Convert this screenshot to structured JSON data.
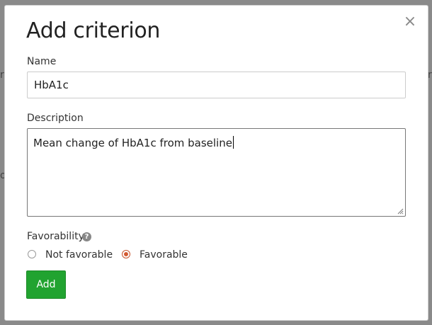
{
  "backdrop": {
    "left_fragment": "r",
    "right_fragment": "r",
    "left_fragment2": "o"
  },
  "dialog": {
    "title": "Add criterion",
    "close_symbol": "×",
    "name": {
      "label": "Name",
      "value": "HbA1c"
    },
    "description": {
      "label": "Description",
      "value": "Mean change of HbA1c from baseline"
    },
    "favorability": {
      "label": "Favorability",
      "help_symbol": "?",
      "options": [
        {
          "label": "Not favorable",
          "checked": false
        },
        {
          "label": "Favorable",
          "checked": true
        }
      ]
    },
    "add_label": "Add"
  },
  "colors": {
    "add_button": "#21a330",
    "radio_checked": "#d35a31"
  }
}
